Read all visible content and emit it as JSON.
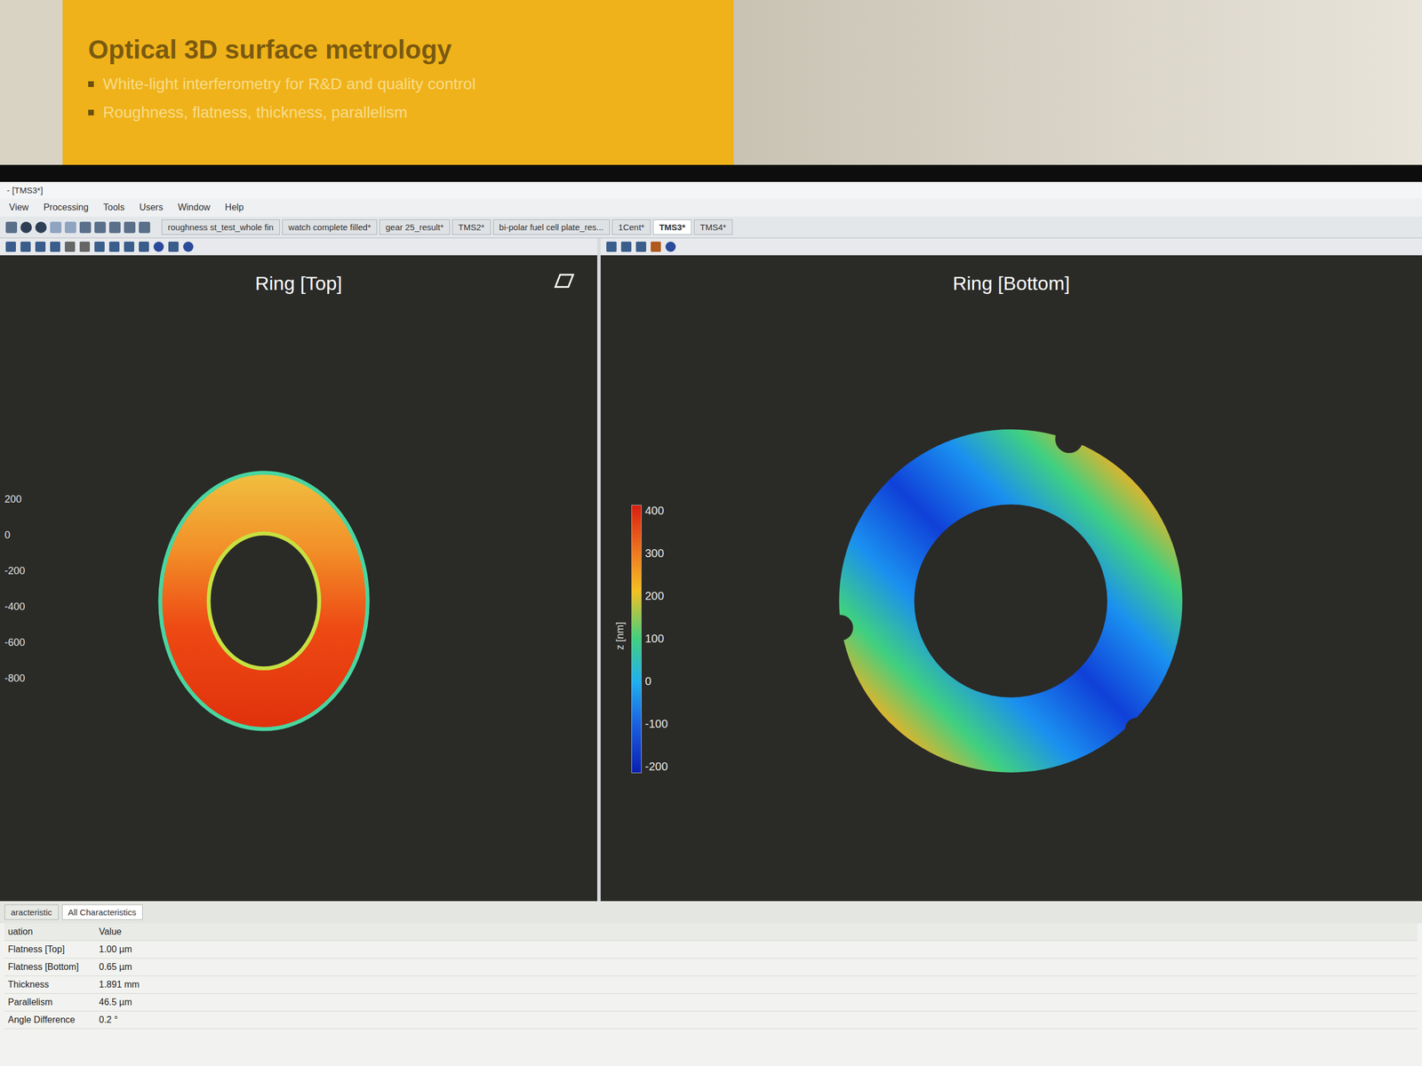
{
  "poster": {
    "title": "Optical 3D surface metrology",
    "bullets": [
      "White-light interferometry for R&D and quality control",
      "Roughness, flatness, thickness, parallelism"
    ]
  },
  "window": {
    "title": "- [TMS3*]"
  },
  "menu": [
    "View",
    "Processing",
    "Tools",
    "Users",
    "Window",
    "Help"
  ],
  "doc_tabs": [
    {
      "label": "roughness st_test_whole fin",
      "selected": false
    },
    {
      "label": "watch complete filled*",
      "selected": false
    },
    {
      "label": "gear 25_result*",
      "selected": false
    },
    {
      "label": "TMS2*",
      "selected": false
    },
    {
      "label": "bi-polar fuel cell plate_res...",
      "selected": false
    },
    {
      "label": "1Cent*",
      "selected": false
    },
    {
      "label": "TMS3*",
      "selected": true
    },
    {
      "label": "TMS4*",
      "selected": false
    }
  ],
  "plots": {
    "top": {
      "title": "Ring [Top]",
      "axis_ticks": [
        "200",
        "0",
        "-200",
        "-400",
        "-600",
        "-800"
      ]
    },
    "bottom": {
      "title": "Ring [Bottom]",
      "colorbar": {
        "label": "z [nm]",
        "ticks": [
          "400",
          "300",
          "200",
          "100",
          "0",
          "-100",
          "-200"
        ]
      }
    }
  },
  "results": {
    "tabs": [
      {
        "label": "aracteristic",
        "selected": false
      },
      {
        "label": "All Characteristics",
        "selected": true
      }
    ],
    "columns": [
      "uation",
      "Value"
    ],
    "rows": [
      {
        "name": "Flatness [Top]",
        "value": "1.00 µm"
      },
      {
        "name": "Flatness [Bottom]",
        "value": "0.65 µm"
      },
      {
        "name": "Thickness",
        "value": "1.891 mm"
      },
      {
        "name": "Parallelism",
        "value": "46.5 µm"
      },
      {
        "name": "Angle Difference",
        "value": "0.2 °"
      }
    ]
  }
}
